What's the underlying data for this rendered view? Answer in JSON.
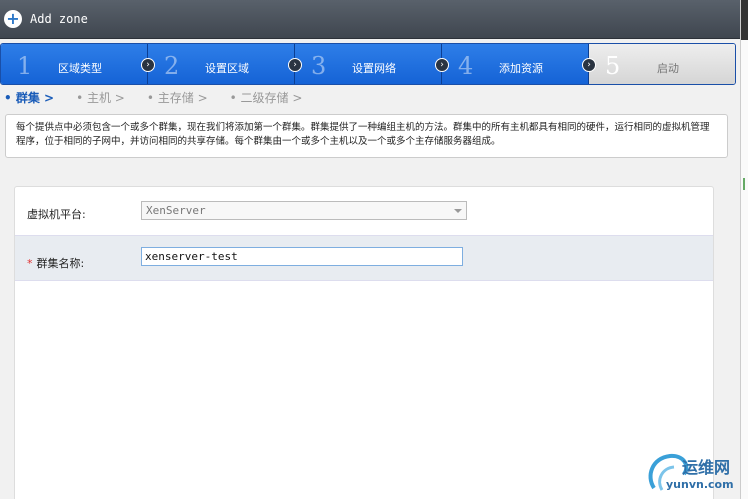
{
  "window": {
    "title": "Add zone",
    "add_icon": "plus-circle-icon"
  },
  "steps": [
    {
      "num": "1",
      "label": "区域类型",
      "state": "done"
    },
    {
      "num": "2",
      "label": "设置区域",
      "state": "done"
    },
    {
      "num": "3",
      "label": "设置网络",
      "state": "done"
    },
    {
      "num": "4",
      "label": "添加资源",
      "state": "current"
    },
    {
      "num": "5",
      "label": "启动",
      "state": "pending"
    }
  ],
  "subnav": [
    {
      "label": "• 群集 >",
      "active": true
    },
    {
      "label": "• 主机 >",
      "active": false
    },
    {
      "label": "• 主存储 >",
      "active": false
    },
    {
      "label": "• 二级存储 >",
      "active": false
    }
  ],
  "description": "每个提供点中必须包含一个或多个群集，现在我们将添加第一个群集。群集提供了一种编组主机的方法。群集中的所有主机都具有相同的硬件，运行相同的虚拟机管理程序，位于相同的子网中，并访问相同的共享存储。每个群集由一个或多个主机以及一个或多个主存储服务器组成。",
  "form": {
    "hypervisor": {
      "label": "虚拟机平台:",
      "value": "XenServer"
    },
    "cluster_name": {
      "required_mark": "*",
      "label": "群集名称:",
      "value": "xenserver-test"
    }
  },
  "watermark": {
    "cn": "运维网",
    "en": "yunvn.com"
  },
  "colors": {
    "accent": "#1563d6",
    "required": "#e03030"
  }
}
